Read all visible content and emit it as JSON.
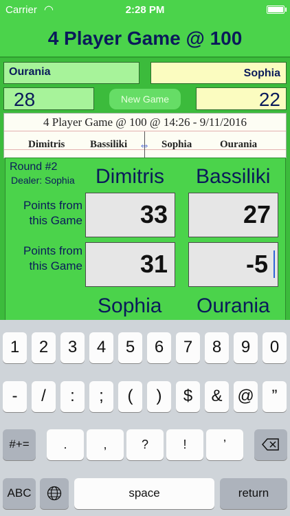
{
  "status": {
    "carrier": "Carrier",
    "time": "2:28 PM",
    "wifi_icon": "wifi-icon",
    "battery_icon": "battery-icon"
  },
  "title": "4 Player Game @ 100",
  "names": {
    "left": "Ourania",
    "right": "Sophia"
  },
  "scores": {
    "left": "28",
    "right": "22"
  },
  "new_game_label": "New Game",
  "sheet": {
    "title": "4 Player Game @ 100 @ 14:26 - 9/11/2016",
    "columns": [
      "Dimitris",
      "Bassiliki",
      "Sophia",
      "Ourania"
    ],
    "swap_icon": "left-right-arrow-icon"
  },
  "round": {
    "label": "Round #2",
    "dealer": "Dealer: Sophia",
    "players": [
      "Dimitris",
      "Bassiliki",
      "Sophia",
      "Ourania"
    ],
    "points_label_line1": "Points from",
    "points_label_line2": "this Game",
    "values": [
      "33",
      "27",
      "31",
      "-5"
    ]
  },
  "keyboard": {
    "row1": [
      "1",
      "2",
      "3",
      "4",
      "5",
      "6",
      "7",
      "8",
      "9",
      "0"
    ],
    "row2": [
      "-",
      "/",
      ":",
      ";",
      "(",
      ")",
      "$",
      "&",
      "@",
      "”"
    ],
    "row3_left": "#+=",
    "row3": [
      ".",
      ",",
      "?",
      "!",
      "’"
    ],
    "backspace_icon": "backspace-icon",
    "abc": "ABC",
    "globe_icon": "globe-icon",
    "space": "space",
    "return": "return"
  }
}
